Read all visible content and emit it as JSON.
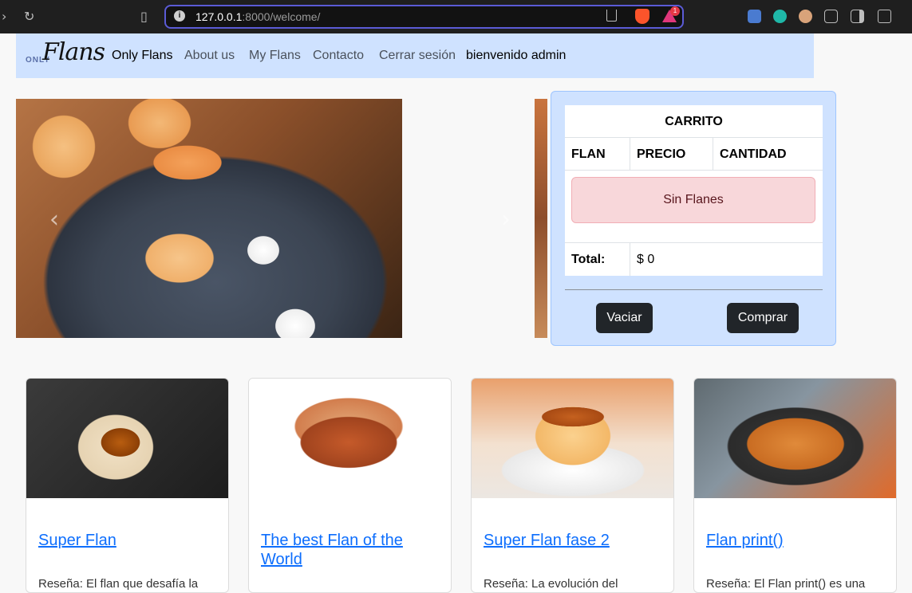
{
  "browser": {
    "url_host": "127.0.0.1",
    "url_path": ":8000/welcome/",
    "notification_count": "1"
  },
  "navbar": {
    "brand_small": "ONLY",
    "brand_script": "Flans",
    "items": [
      {
        "label": "Only Flans"
      },
      {
        "label": "About us"
      },
      {
        "label": "My Flans"
      },
      {
        "label": "Contacto"
      },
      {
        "label": "Cerrar sesión"
      },
      {
        "label": "bienvenido admin"
      }
    ]
  },
  "carousel": {
    "prev_glyph": "‹",
    "next_glyph": "›"
  },
  "cart": {
    "title": "CARRITO",
    "columns": [
      "FLAN",
      "PRECIO",
      "CANTIDAD"
    ],
    "empty_message": "Sin Flanes",
    "total_label": "Total:",
    "total_value": "$ 0",
    "empty_button": "Vaciar",
    "buy_button": "Comprar"
  },
  "cards": [
    {
      "title": "Super Flan",
      "text": "Reseña: El flan que desafía la"
    },
    {
      "title": "The best Flan of the World",
      "text": ""
    },
    {
      "title": "Super Flan fase 2",
      "text": "Reseña: La evolución del"
    },
    {
      "title": "Flan print()",
      "text": "Reseña: El Flan print() es una"
    }
  ],
  "colors": {
    "navbar_bg": "#cfe2ff",
    "link": "#0d6efd",
    "alert_bg": "#f8d7da",
    "button_dark": "#212529"
  }
}
